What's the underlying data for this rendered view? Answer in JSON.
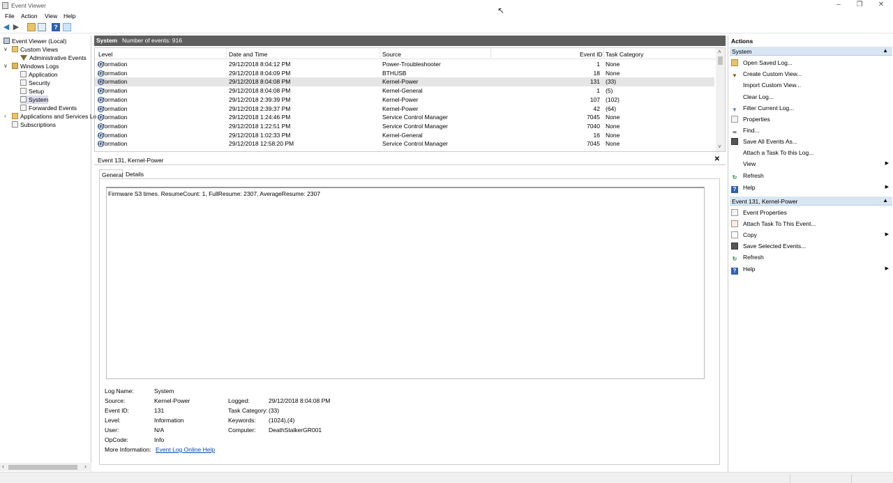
{
  "window": {
    "title": "Event Viewer",
    "controls": [
      "–",
      "❐",
      "✕"
    ]
  },
  "menu": [
    "File",
    "Action",
    "View",
    "Help"
  ],
  "tree": {
    "root": "Event Viewer (Local)",
    "custom_views": "Custom Views",
    "admin_events": "Administrative Events",
    "windows_logs": "Windows Logs",
    "application": "Application",
    "security": "Security",
    "setup": "Setup",
    "system": "System",
    "forwarded": "Forwarded Events",
    "apps_services": "Applications and Services Lo",
    "subscriptions": "Subscriptions"
  },
  "log": {
    "name": "System",
    "count_label": "Number of events: 916",
    "columns": [
      "Level",
      "Date and Time",
      "Source",
      "Event ID",
      "Task Category"
    ],
    "rows": [
      {
        "level": "Information",
        "date": "29/12/2018 8:04:12 PM",
        "source": "Power-Troubleshooter",
        "id": "1",
        "task": "None"
      },
      {
        "level": "Information",
        "date": "29/12/2018 8:04:09 PM",
        "source": "BTHUSB",
        "id": "18",
        "task": "None"
      },
      {
        "level": "Information",
        "date": "29/12/2018 8:04:08 PM",
        "source": "Kernel-Power",
        "id": "131",
        "task": "(33)"
      },
      {
        "level": "Information",
        "date": "29/12/2018 8:04:08 PM",
        "source": "Kernel-General",
        "id": "1",
        "task": "(5)"
      },
      {
        "level": "Information",
        "date": "29/12/2018 2:39:39 PM",
        "source": "Kernel-Power",
        "id": "107",
        "task": "(102)"
      },
      {
        "level": "Information",
        "date": "29/12/2018 2:39:37 PM",
        "source": "Kernel-Power",
        "id": "42",
        "task": "(64)"
      },
      {
        "level": "Information",
        "date": "29/12/2018 1:24:46 PM",
        "source": "Service Control Manager",
        "id": "7045",
        "task": "None"
      },
      {
        "level": "Information",
        "date": "29/12/2018 1:22:51 PM",
        "source": "Service Control Manager",
        "id": "7040",
        "task": "None"
      },
      {
        "level": "Information",
        "date": "29/12/2018 1:02:33 PM",
        "source": "Kernel-General",
        "id": "16",
        "task": "None"
      },
      {
        "level": "Information",
        "date": "29/12/2018 12:58:20 PM",
        "source": "Service Control Manager",
        "id": "7045",
        "task": "None"
      }
    ]
  },
  "detail": {
    "header": "Event 131, Kernel-Power",
    "tabs": [
      "General",
      "Details"
    ],
    "description": "Firmware S3 times. ResumeCount: 1, FullResume: 2307, AverageResume: 2307",
    "labels": {
      "log_name": "Log Name:",
      "source": "Source:",
      "event_id": "Event ID:",
      "level": "Level:",
      "user": "User:",
      "opcode": "OpCode:",
      "more_info": "More Information:",
      "logged": "Logged:",
      "task_category": "Task Category:",
      "keywords": "Keywords:",
      "computer": "Computer:"
    },
    "values": {
      "log_name": "System",
      "source": "Kernel-Power",
      "event_id": "131",
      "level": "Information",
      "user": "N/A",
      "opcode": "Info",
      "more_info": "Event Log Online Help",
      "logged": "29/12/2018 8:04:08 PM",
      "task_category": "(33)",
      "keywords": "(1024),(4)",
      "computer": "DeathStalkerGR001"
    }
  },
  "actions": {
    "title": "Actions",
    "section1": "System",
    "section1_items": [
      "Open Saved Log...",
      "Create Custom View...",
      "Import Custom View...",
      "Clear Log...",
      "Filter Current Log...",
      "Properties",
      "Find...",
      "Save All Events As...",
      "Attach a Task To this Log...",
      "View",
      "Refresh",
      "Help"
    ],
    "section2": "Event 131, Kernel-Power",
    "section2_items": [
      "Event Properties",
      "Attach Task To This Event...",
      "Copy",
      "Save Selected Events...",
      "Refresh",
      "Help"
    ]
  }
}
